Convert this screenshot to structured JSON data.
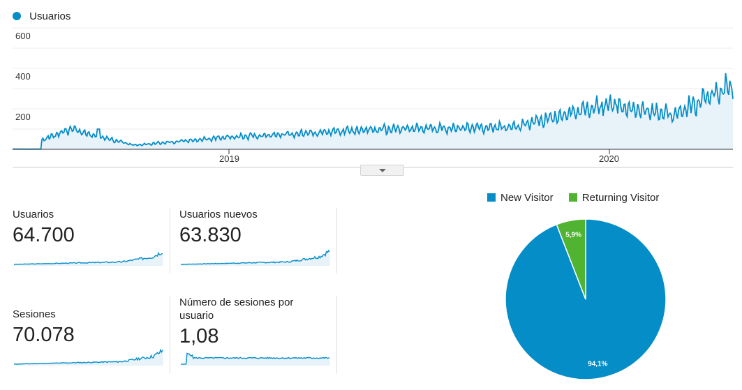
{
  "main_chart": {
    "legend": "Usuarios",
    "y_ticks": [
      "600",
      "400",
      "200"
    ],
    "x_ticks": [
      "2019",
      "2020"
    ],
    "color": "#058dc7",
    "fill": "#e7f2f9"
  },
  "metrics": [
    {
      "label": "Usuarios",
      "value": "64.700"
    },
    {
      "label": "Usuarios nuevos",
      "value": "63.830"
    },
    {
      "label": "Sesiones",
      "value": "70.078"
    },
    {
      "label": "Número de sesiones por usuario",
      "value": "1,08"
    }
  ],
  "pie": {
    "legend": [
      {
        "label": "New Visitor",
        "color": "#058dc7"
      },
      {
        "label": "Returning Visitor",
        "color": "#50b432"
      }
    ],
    "labels": [
      "94,1%",
      "5,9%"
    ]
  },
  "chart_data": [
    {
      "type": "line",
      "series": [
        {
          "name": "Usuarios"
        }
      ],
      "x_tick_labels": [
        "2019",
        "2020"
      ],
      "y_tick_labels": [
        "200",
        "400",
        "600"
      ],
      "ylim": [
        0,
        600
      ],
      "approx_trend": [
        {
          "x": "2018-05",
          "y": 5
        },
        {
          "x": "2018-07",
          "y": 40
        },
        {
          "x": "2018-08",
          "y": 100
        },
        {
          "x": "2018-10",
          "y": 20
        },
        {
          "x": "2019-01",
          "y": 60
        },
        {
          "x": "2019-06",
          "y": 100
        },
        {
          "x": "2019-10",
          "y": 110
        },
        {
          "x": "2019-11",
          "y": 150
        },
        {
          "x": "2020-01",
          "y": 220
        },
        {
          "x": "2020-03",
          "y": 170
        },
        {
          "x": "2020-06",
          "y": 400
        },
        {
          "x": "2020-07",
          "y": 460
        }
      ]
    },
    {
      "type": "pie",
      "categories": [
        "New Visitor",
        "Returning Visitor"
      ],
      "values": [
        94.1,
        5.9
      ]
    }
  ]
}
